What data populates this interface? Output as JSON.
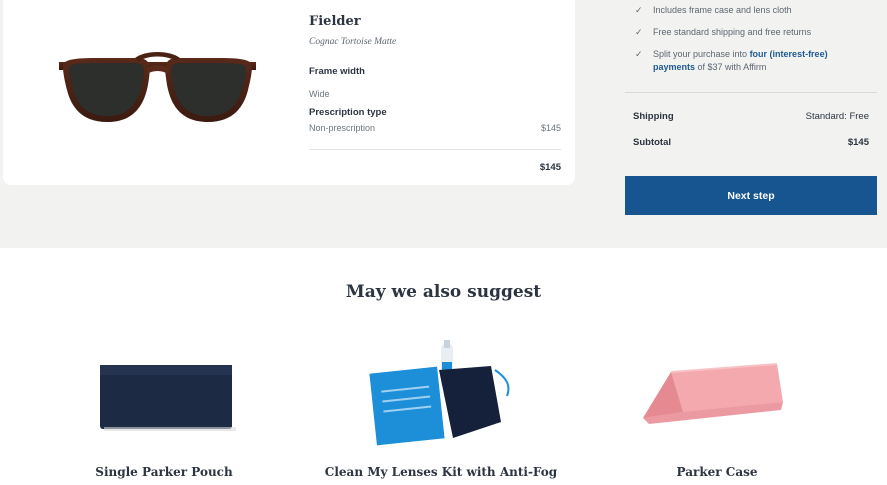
{
  "cart_item": {
    "name": "Fielder",
    "color": "Cognac Tortoise Matte",
    "frame_width_label": "Frame width",
    "frame_width_value": "Wide",
    "prescription_label": "Prescription type",
    "prescription_value": "Non-prescription",
    "prescription_price": "$145",
    "total": "$145"
  },
  "summary": {
    "perks": [
      "Includes frame case and lens cloth",
      "Free standard shipping and free returns"
    ],
    "affirm": {
      "prefix": "Split your purchase into ",
      "link": "four (interest-free) payments",
      "suffix": " of $37 with Affirm"
    },
    "shipping_label": "Shipping",
    "shipping_value": "Standard: Free",
    "subtotal_label": "Subtotal",
    "subtotal_value": "$145",
    "next_button": "Next step"
  },
  "suggestions": {
    "title": "May we also suggest",
    "items": [
      {
        "name": "Single Parker Pouch"
      },
      {
        "name": "Clean My Lenses Kit with Anti-Fog"
      },
      {
        "name": "Parker Case"
      }
    ]
  },
  "colors": {
    "accent": "#175591",
    "link": "#1f5a94",
    "band": "#f2f2f1"
  }
}
